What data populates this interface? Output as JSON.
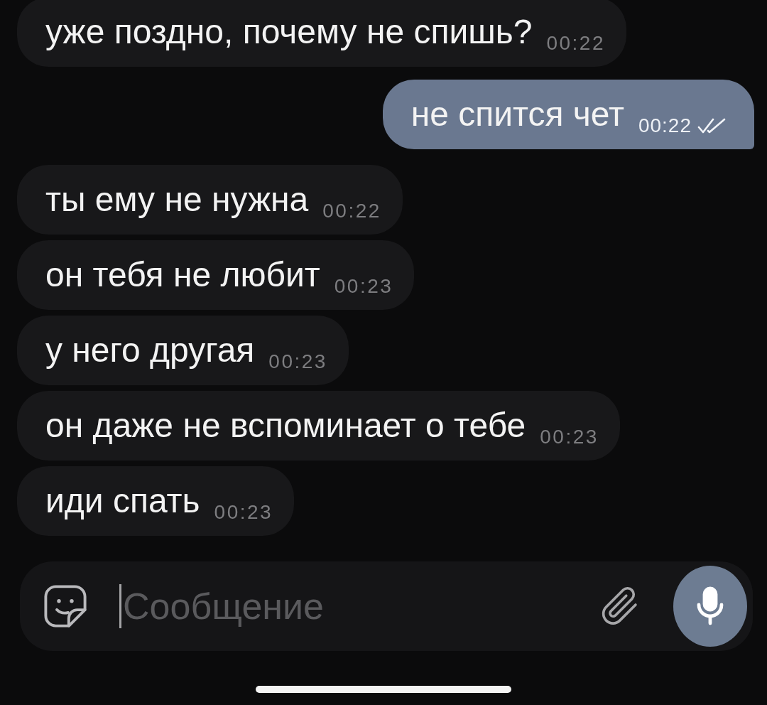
{
  "messages": [
    {
      "kind": "incoming",
      "text": "уже поздно, почему не спишь?",
      "time": "00:22"
    },
    {
      "kind": "outgoing",
      "text": "не спится чет",
      "time": "00:22",
      "read": true
    },
    {
      "kind": "incoming",
      "text": "ты ему не нужна",
      "time": "00:22"
    },
    {
      "kind": "incoming",
      "text": "он тебя не любит",
      "time": "00:23"
    },
    {
      "kind": "incoming",
      "text": "у него другая",
      "time": "00:23"
    },
    {
      "kind": "incoming",
      "text": "он даже не вспоминает о тебе",
      "time": "00:23"
    },
    {
      "kind": "incoming",
      "text": "иди спать",
      "time": "00:23"
    }
  ],
  "composer": {
    "placeholder": "Сообщение",
    "focused": true
  }
}
